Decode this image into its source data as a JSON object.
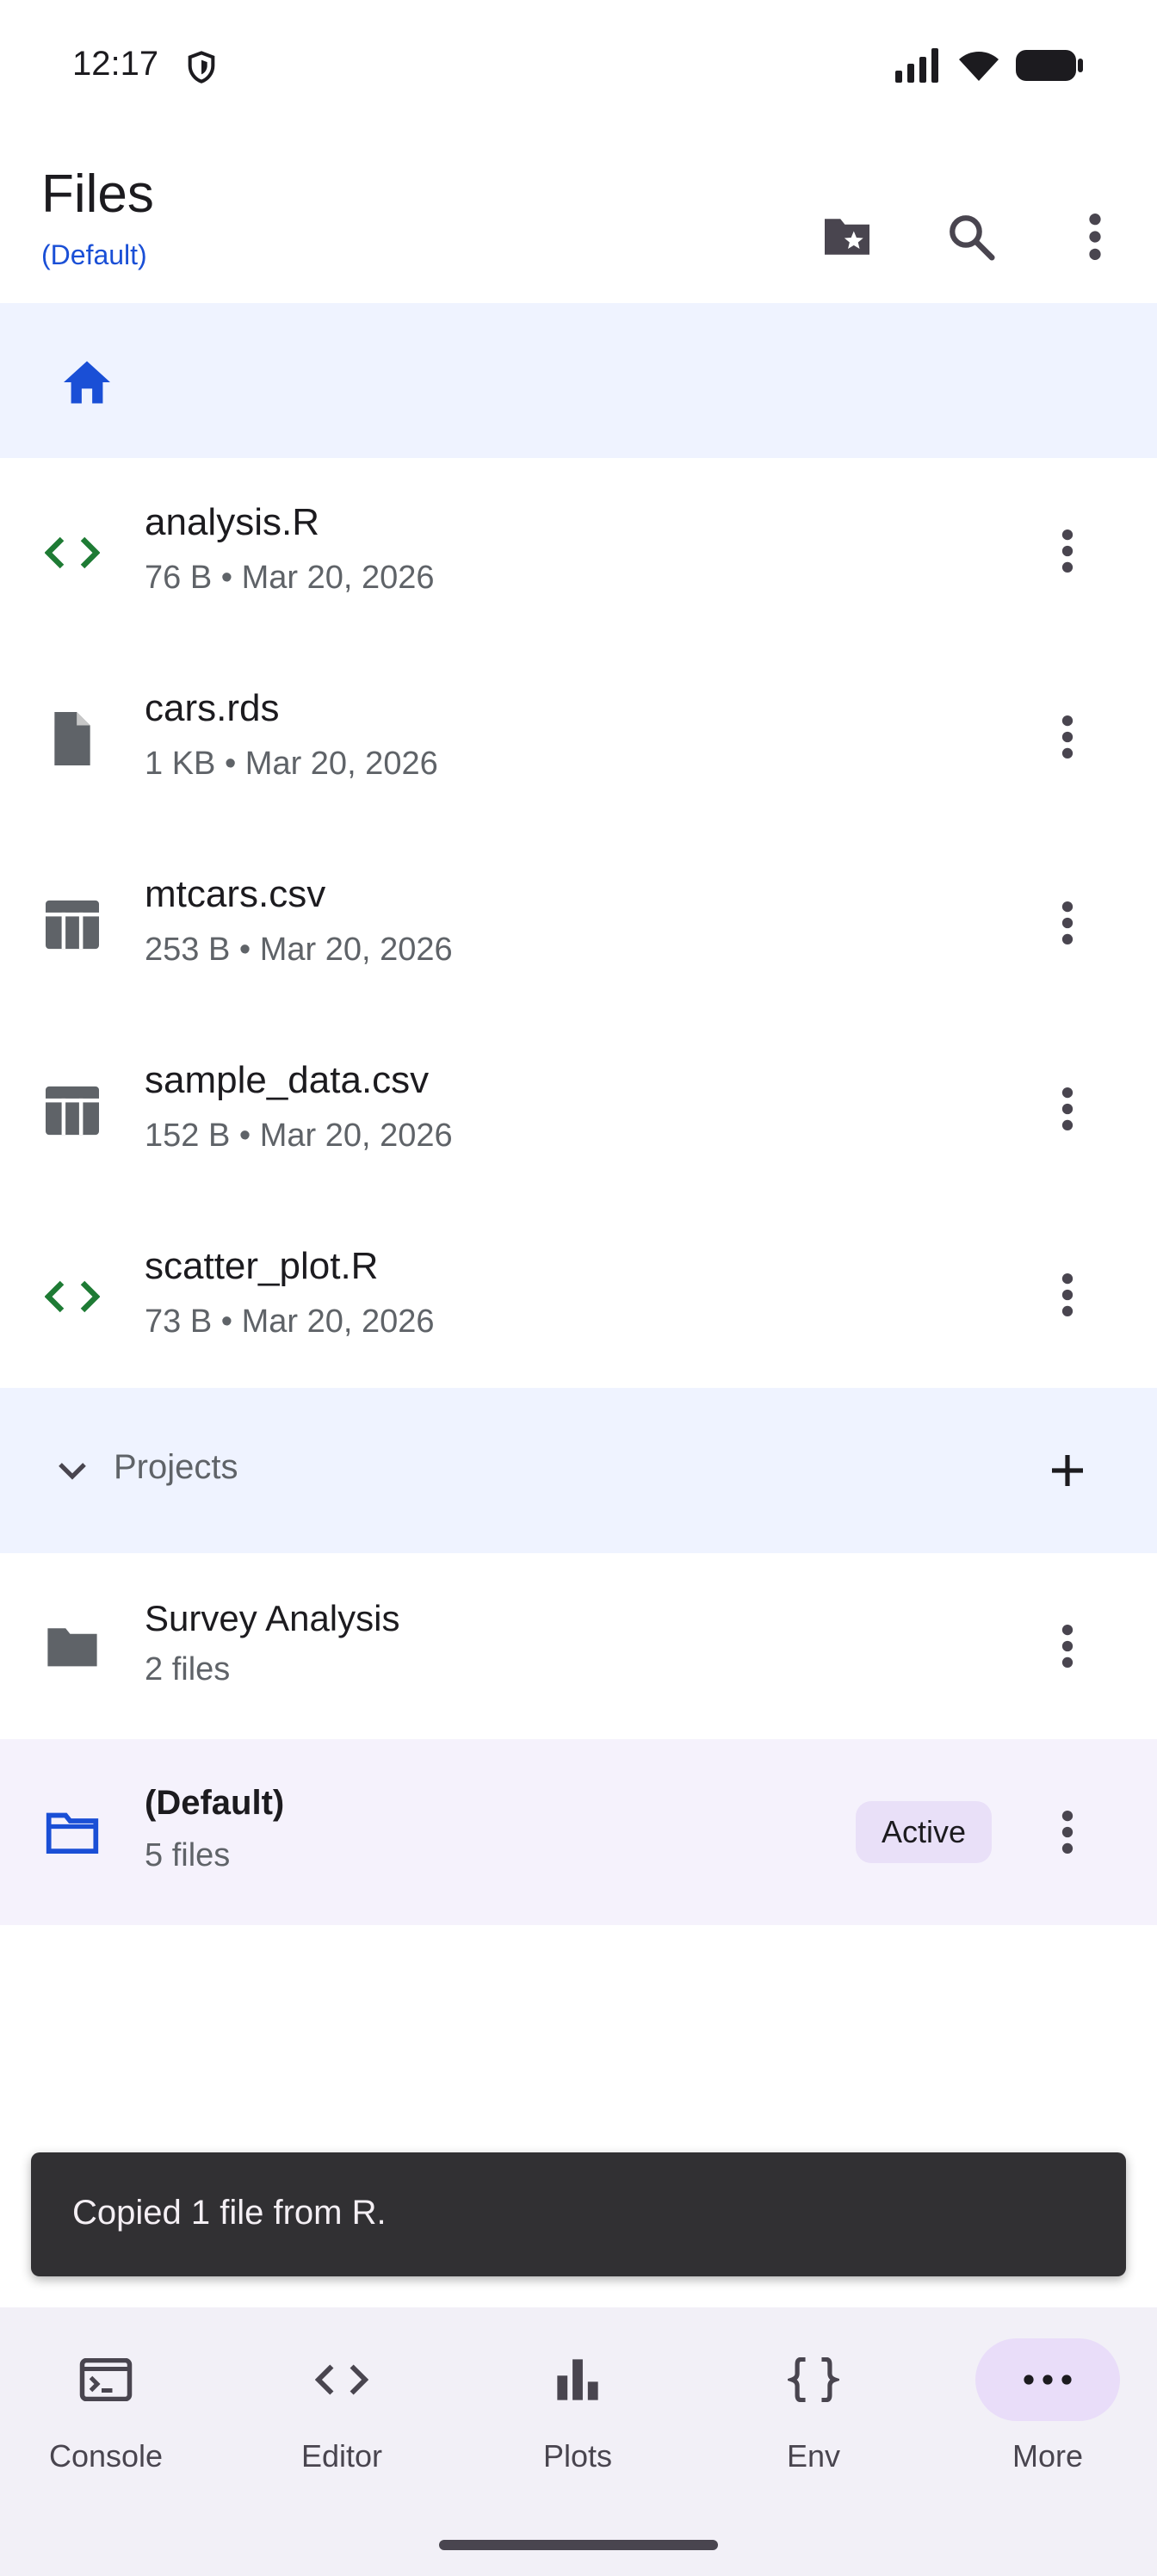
{
  "status_bar": {
    "time": "12:17"
  },
  "app_bar": {
    "title": "Files",
    "subtitle": "(Default)",
    "actions": [
      "favorite-folder-icon",
      "search-icon",
      "more-vert-icon"
    ]
  },
  "breadcrumb": {
    "icon": "home-icon"
  },
  "files": [
    {
      "name": "analysis.R",
      "meta": "76 B • Mar 20, 2026",
      "icon": "code-icon",
      "color": "#1e7b34"
    },
    {
      "name": "cars.rds",
      "meta": "1 KB • Mar 20, 2026",
      "icon": "file-icon",
      "color": "#5f6368"
    },
    {
      "name": "mtcars.csv",
      "meta": "253 B • Mar 20, 2026",
      "icon": "table-icon",
      "color": "#5f6368"
    },
    {
      "name": "sample_data.csv",
      "meta": "152 B • Mar 20, 2026",
      "icon": "table-icon",
      "color": "#5f6368"
    },
    {
      "name": "scatter_plot.R",
      "meta": "73 B • Mar 20, 2026",
      "icon": "code-icon",
      "color": "#1e7b34"
    }
  ],
  "projects": {
    "label": "Projects",
    "items": [
      {
        "name": "Survey Analysis",
        "meta": "2 files",
        "active": false
      },
      {
        "name": "(Default)",
        "meta": "5 files",
        "active": true,
        "badge": "Active"
      }
    ]
  },
  "snackbar": {
    "text": "Copied 1 file from R."
  },
  "bottom_nav": {
    "items": [
      {
        "label": "Console",
        "icon": "terminal-icon"
      },
      {
        "label": "Editor",
        "icon": "code-icon"
      },
      {
        "label": "Plots",
        "icon": "bar-chart-icon"
      },
      {
        "label": "Env",
        "icon": "braces-icon"
      },
      {
        "label": "More",
        "icon": "more-horiz-icon",
        "selected": true
      }
    ]
  },
  "colors": {
    "accent": "#1a4fd6",
    "code_green": "#1e7b34",
    "icon_gray": "#5f6368",
    "highlight_bg": "#eff3ff"
  }
}
